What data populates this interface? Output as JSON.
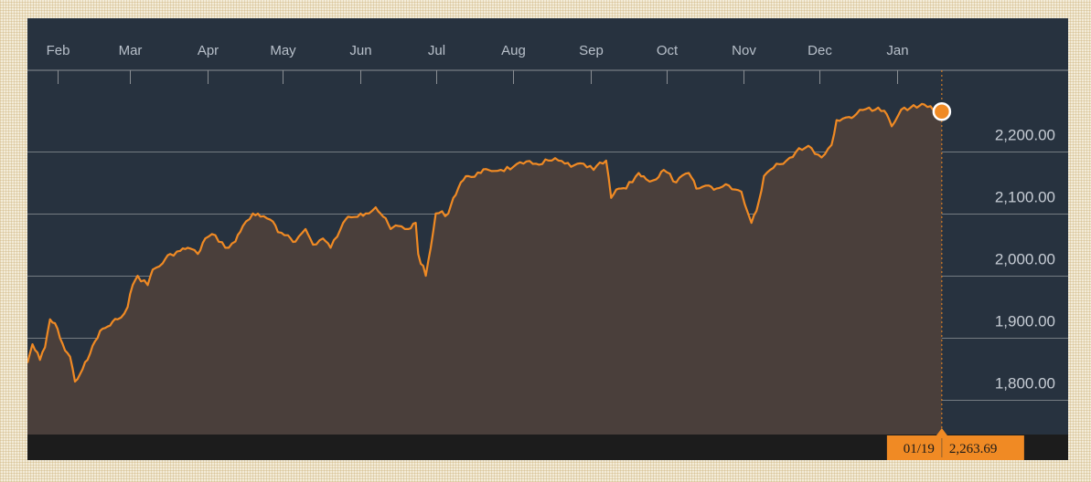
{
  "colors": {
    "background": "#27323f",
    "line": "#f08a24",
    "fill": "#4a3f3b",
    "gridline": "#8a8e93",
    "bottom_bar": "#1c1c1c",
    "tag": "#f08a24"
  },
  "current": {
    "date_label": "01/19",
    "value_label": "2,263.69",
    "value": 2263.69
  },
  "chart_data": {
    "type": "area",
    "title": "",
    "xlabel": "",
    "ylabel": "",
    "x_ticks": [
      "Feb",
      "Mar",
      "Apr",
      "May",
      "Jun",
      "Jul",
      "Aug",
      "Sep",
      "Oct",
      "Nov",
      "Dec",
      "Jan"
    ],
    "y_ticks": [
      {
        "value": 1800,
        "label": "1,800.00"
      },
      {
        "value": 1900,
        "label": "1,900.00"
      },
      {
        "value": 2000,
        "label": "2,000.00"
      },
      {
        "value": 2100,
        "label": "2,100.00"
      },
      {
        "value": 2200,
        "label": "2,200.00"
      }
    ],
    "ylim": [
      1745,
      2330
    ],
    "xlim": [
      "2016-01-20",
      "2017-01-30"
    ],
    "grid": true,
    "series": [
      {
        "x": [
          "2016-01-20",
          "2016-01-22",
          "2016-01-25",
          "2016-01-27",
          "2016-01-29",
          "2016-02-01",
          "2016-02-04",
          "2016-02-06",
          "2016-02-08",
          "2016-02-11",
          "2016-02-13",
          "2016-02-16",
          "2016-02-19",
          "2016-02-22",
          "2016-02-25",
          "2016-02-29",
          "2016-03-02",
          "2016-03-04",
          "2016-03-08",
          "2016-03-10",
          "2016-03-14",
          "2016-03-17",
          "2016-03-21",
          "2016-03-24",
          "2016-03-28",
          "2016-03-31",
          "2016-04-04",
          "2016-04-08",
          "2016-04-12",
          "2016-04-15",
          "2016-04-19",
          "2016-04-22",
          "2016-04-26",
          "2016-04-29",
          "2016-05-03",
          "2016-05-06",
          "2016-05-10",
          "2016-05-13",
          "2016-05-17",
          "2016-05-20",
          "2016-05-24",
          "2016-05-27",
          "2016-06-01",
          "2016-06-03",
          "2016-06-07",
          "2016-06-10",
          "2016-06-13",
          "2016-06-16",
          "2016-06-20",
          "2016-06-23",
          "2016-06-24",
          "2016-06-27",
          "2016-06-29",
          "2016-07-01",
          "2016-07-06",
          "2016-07-08",
          "2016-07-11",
          "2016-07-14",
          "2016-07-19",
          "2016-07-22",
          "2016-07-27",
          "2016-08-01",
          "2016-08-05",
          "2016-08-10",
          "2016-08-15",
          "2016-08-19",
          "2016-08-24",
          "2016-08-29",
          "2016-09-02",
          "2016-09-07",
          "2016-09-09",
          "2016-09-12",
          "2016-09-15",
          "2016-09-20",
          "2016-09-23",
          "2016-09-27",
          "2016-09-30",
          "2016-10-05",
          "2016-10-10",
          "2016-10-13",
          "2016-10-18",
          "2016-10-21",
          "2016-10-26",
          "2016-10-31",
          "2016-11-04",
          "2016-11-07",
          "2016-11-09",
          "2016-11-14",
          "2016-11-18",
          "2016-11-23",
          "2016-11-28",
          "2016-12-02",
          "2016-12-06",
          "2016-12-08",
          "2016-12-13",
          "2016-12-16",
          "2016-12-21",
          "2016-12-27",
          "2016-12-30",
          "2017-01-04",
          "2017-01-09",
          "2017-01-12",
          "2017-01-17",
          "2017-01-19"
        ],
        "y": [
          1860,
          1890,
          1865,
          1885,
          1930,
          1915,
          1880,
          1870,
          1830,
          1850,
          1865,
          1895,
          1915,
          1920,
          1930,
          1950,
          1985,
          2000,
          1985,
          2010,
          2020,
          2035,
          2040,
          2045,
          2035,
          2060,
          2065,
          2045,
          2055,
          2080,
          2100,
          2095,
          2090,
          2070,
          2065,
          2055,
          2075,
          2050,
          2060,
          2045,
          2075,
          2095,
          2100,
          2100,
          2110,
          2095,
          2075,
          2080,
          2075,
          2085,
          2035,
          2000,
          2045,
          2100,
          2100,
          2125,
          2150,
          2160,
          2165,
          2170,
          2170,
          2175,
          2180,
          2180,
          2185,
          2185,
          2175,
          2180,
          2170,
          2185,
          2125,
          2140,
          2140,
          2165,
          2155,
          2155,
          2170,
          2150,
          2165,
          2140,
          2145,
          2140,
          2145,
          2135,
          2085,
          2120,
          2160,
          2180,
          2185,
          2205,
          2205,
          2190,
          2210,
          2250,
          2255,
          2260,
          2270,
          2265,
          2240,
          2270,
          2270,
          2275,
          2265,
          2263.69
        ]
      }
    ]
  }
}
